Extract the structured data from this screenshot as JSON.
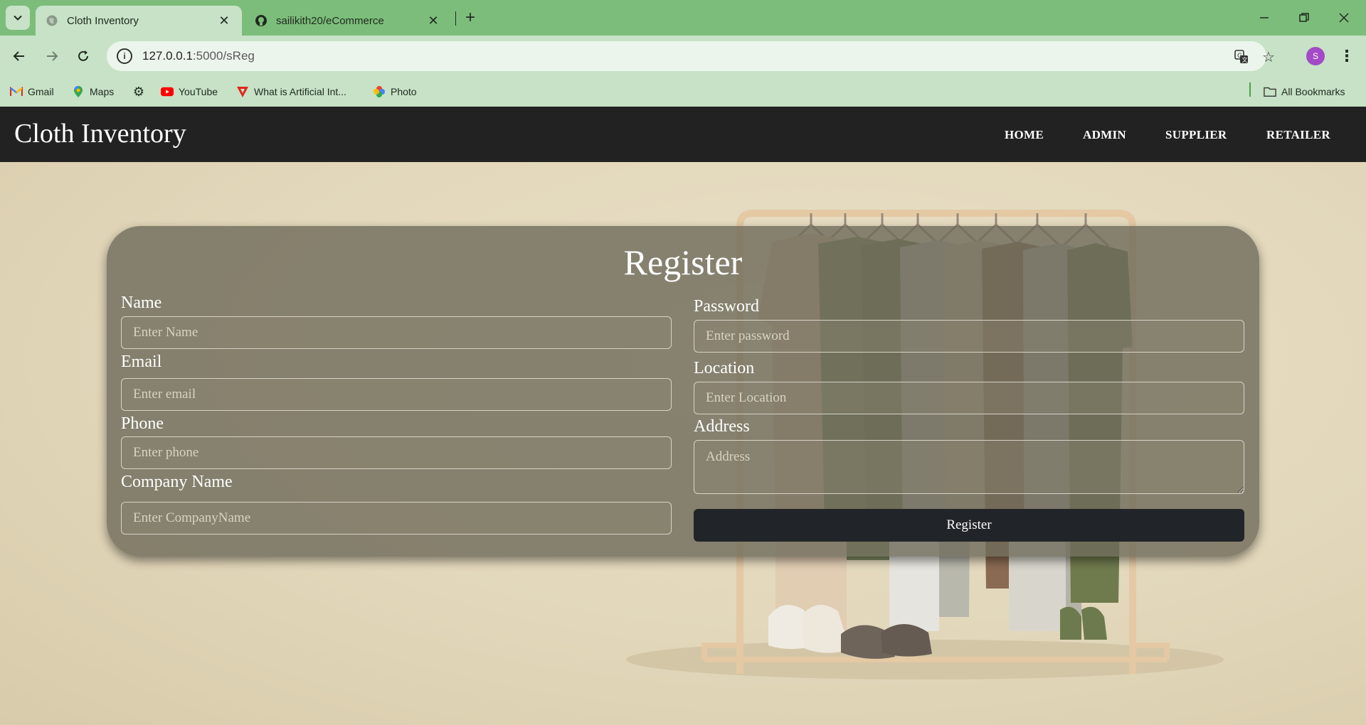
{
  "browser": {
    "tabs": [
      {
        "title": "Cloth Inventory",
        "active": true,
        "icon": "globe-icon"
      },
      {
        "title": "sailikith20/eCommerce",
        "active": false,
        "icon": "github-icon"
      }
    ],
    "url_host": "127.0.0.1",
    "url_path": ":5000/sReg",
    "profile_initial": "S",
    "bookmarks": [
      {
        "label": "Gmail",
        "icon": "gmail-icon"
      },
      {
        "label": "Maps",
        "icon": "maps-icon"
      },
      {
        "label": "",
        "icon": "gear-icon"
      },
      {
        "label": "YouTube",
        "icon": "youtube-icon"
      },
      {
        "label": "What is Artificial Int...",
        "icon": "triangle-logo-icon"
      },
      {
        "label": "Photo",
        "icon": "photos-icon"
      }
    ],
    "all_bookmarks_label": "All Bookmarks"
  },
  "site": {
    "brand": "Cloth Inventory",
    "nav": [
      "HOME",
      "ADMIN",
      "SUPPLIER",
      "RETAILER"
    ]
  },
  "form": {
    "title": "Register",
    "left": [
      {
        "label": "Name",
        "placeholder": "Enter Name"
      },
      {
        "label": "Email",
        "placeholder": "Enter email"
      },
      {
        "label": "Phone",
        "placeholder": "Enter phone"
      },
      {
        "label": "Company Name",
        "placeholder": "Enter CompanyName"
      }
    ],
    "right": [
      {
        "label": "Password",
        "placeholder": "Enter password"
      },
      {
        "label": "Location",
        "placeholder": "Enter Location"
      },
      {
        "label": "Address",
        "placeholder": "Address"
      }
    ],
    "submit_label": "Register"
  },
  "colors": {
    "tab_bar": "#7dbd7b",
    "toolbar": "#c7e2c6",
    "site_nav": "#222222",
    "card": "#6e6a5a",
    "button": "#212529",
    "background": "#e3d8bc"
  }
}
